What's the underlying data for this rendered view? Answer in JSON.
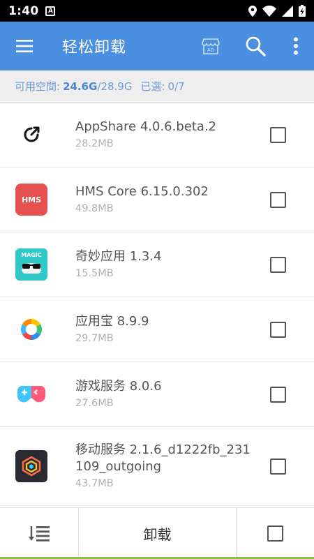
{
  "status_bar": {
    "time": "1:40",
    "notif": "A"
  },
  "app_bar": {
    "title": "轻松卸载",
    "ad_label": "AD"
  },
  "storage": {
    "available_label": "可用空間:",
    "available_value": "24.6G",
    "total": "/28.9G",
    "selected_label": "已選:",
    "selected_value": "0/7"
  },
  "apps": [
    {
      "name": "AppShare 4.0.6.beta.2",
      "size": "28.2MB",
      "icon": "appshare-icon"
    },
    {
      "name": "HMS Core 6.15.0.302",
      "size": "49.8MB",
      "icon": "hms-core-icon",
      "icon_text": "HMS"
    },
    {
      "name": "奇妙应用 1.3.4",
      "size": "15.5MB",
      "icon": "magic-app-icon",
      "icon_text": "MAGIC"
    },
    {
      "name": "应用宝 8.9.9",
      "size": "29.7MB",
      "icon": "yingyongbao-icon"
    },
    {
      "name": "游戏服务 8.0.6",
      "size": "27.6MB",
      "icon": "game-service-icon"
    },
    {
      "name": "移动服务 2.1.6_d1222fb_231109_outgoing",
      "size": "43.7MB",
      "icon": "mobile-service-icon"
    }
  ],
  "bottom_bar": {
    "uninstall_label": "卸载"
  },
  "colors": {
    "primary": "#4a8fe0",
    "accent": "#8bc34a"
  }
}
